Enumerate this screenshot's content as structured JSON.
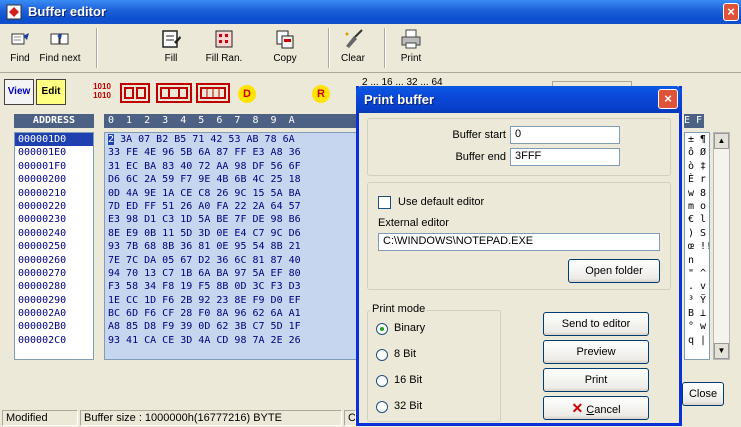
{
  "window": {
    "title": "Buffer editor",
    "close_glyph": "×"
  },
  "toolbar1": {
    "find": "Find",
    "find_next": "Find next",
    "fill": "Fill",
    "fill_random": "Fill Ran.",
    "copy": "Copy",
    "clear": "Clear",
    "print": "Print"
  },
  "toolbar2": {
    "view": "View",
    "edit": "Edit",
    "binary_icon": "1010\n1010",
    "d_label": "D",
    "r_label": "R",
    "partial_text": "2 ... 16 ... 32 ... 64"
  },
  "editor": {
    "address_header": "ADDRESS",
    "hex_header": "0  1  2  3  4  5  6  7  8  9  A",
    "ascii_header": "E F",
    "addresses": [
      "000001D0",
      "000001E0",
      "000001F0",
      "00000200",
      "00000210",
      "00000220",
      "00000230",
      "00000240",
      "00000250",
      "00000260",
      "00000270",
      "00000280",
      "00000290",
      "000002A0",
      "000002B0",
      "000002C0"
    ],
    "hex_rows": [
      "3A 07 B2 B5 71 42 53 AB 78 6A",
      "33 FE 4E 96 5B 6A 87 FF E3 A8 36",
      "31 EC BA 83 40 72 AA 98 DF 56 6F",
      "D6 6C 2A 59 F7 9E 4B 6B 4C 25 18",
      "0D 4A 9E 1A CE C8 26 9C 15 5A BA",
      "7D ED FF 51 26 A0 FA 22 2A 64 57",
      "E3 98 D1 C3 1D 5A BE 7F DE 98 B6",
      "8E E9 0B 11 5D 3D 0E E4 C7 9C D6",
      "93 7B 68 8B 36 81 0E 95 54 8B 21",
      "7E 7C DA 05 67 D2 36 6C 81 87 40",
      "94 70 13 C7 1B 6A BA 97 5A EF 80",
      "F3 58 34 F8 19 F5 8B 0D 3C F3 D3",
      "1E CC 1D F6 2B 92 23 8E F9 D0 EF",
      "BC 6D F6 CF 28 F0 8A 96 62 6A A1",
      "A8 85 D8 F9 39 0D 62 3B C7 5D 1F",
      "93 41 CA CE 3D 4A CD 98 7A 2E 26"
    ],
    "cursor_hex": "2",
    "ascii_rows": [
      "± ¶",
      "ô Ø",
      "ò ‡",
      "È r",
      "w 8",
      "m o",
      "€ l",
      ") S",
      "œ !!",
      "n",
      "\" ^",
      ". v",
      "³ Ÿ",
      "B ⊥",
      "° w",
      "q |"
    ]
  },
  "close_button": "Close",
  "status": {
    "mode": "Modified",
    "buffer_size": "Buffer size : 1000000h(16777216) BYTE",
    "extra": "C"
  },
  "dialog": {
    "title": "Print buffer",
    "close_glyph": "×",
    "buffer_start_label": "Buffer start",
    "buffer_start_value": "0",
    "buffer_end_label": "Buffer end",
    "buffer_end_value": "3FFF",
    "use_default_editor": "Use default editor",
    "external_editor_label": "External editor",
    "external_editor_value": "C:\\WINDOWS\\NOTEPAD.EXE",
    "open_folder": "Open folder",
    "print_mode_label": "Print mode",
    "modes": [
      "Binary",
      "8 Bit",
      "16 Bit",
      "32 Bit"
    ],
    "selected_mode": "Binary",
    "send_to_editor": "Send to editor",
    "preview": "Preview",
    "print": "Print",
    "cancel": "Cancel",
    "cancel_mnemonic": "C",
    "cancel_rest": "ancel"
  }
}
